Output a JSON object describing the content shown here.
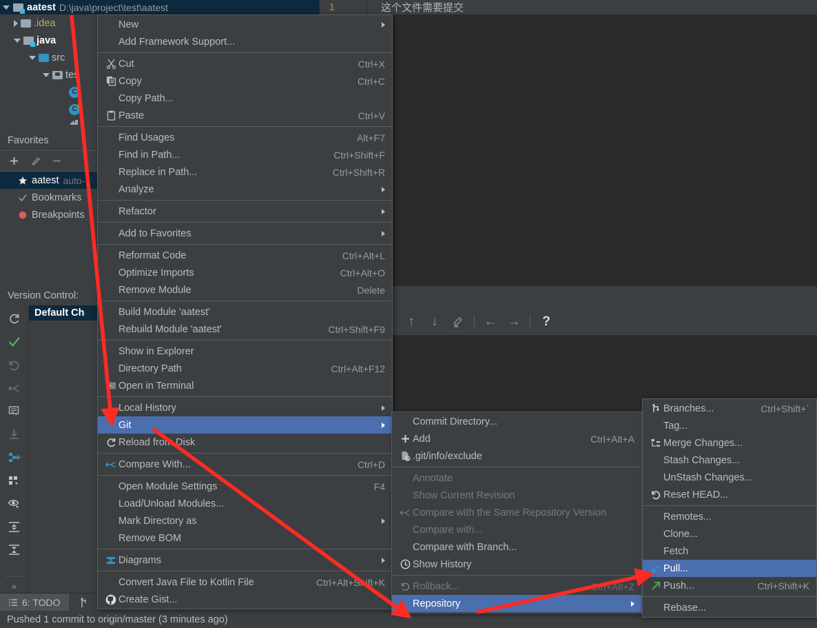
{
  "project_header": {
    "name": "aatest",
    "path": "D:\\java\\project\\test\\aatest",
    "expand_icon": "triangle-down-icon",
    "folder_icon": "module-folder-icon"
  },
  "editor_top": {
    "line_number": "1",
    "note": "这个文件需要提交"
  },
  "project_tree": {
    "items": [
      {
        "label": ".idea",
        "icon": "folder-icon",
        "arrow": "triangle-right-icon",
        "indent": 20,
        "style": "idea"
      },
      {
        "label": "java",
        "icon": "module-folder-icon",
        "arrow": "triangle-down-icon",
        "indent": 20,
        "style": "java"
      },
      {
        "label": "src",
        "icon": "source-folder-icon",
        "arrow": "triangle-down-icon",
        "indent": 42,
        "style": ""
      },
      {
        "label": "tes",
        "icon": "test-folder-icon",
        "arrow": "triangle-down-icon",
        "indent": 62,
        "style": ""
      },
      {
        "label": "",
        "icon": "class-icon",
        "arrow": "",
        "indent": 98,
        "style": ""
      },
      {
        "label": "",
        "icon": "runnable-class-icon",
        "arrow": "",
        "indent": 98,
        "style": ""
      },
      {
        "label": "",
        "icon": "resource-icon",
        "arrow": "",
        "indent": 98,
        "style": ""
      }
    ]
  },
  "favorites": {
    "title": "Favorites",
    "toolbar": [
      {
        "name": "add-favorite-button",
        "glyph": "+"
      },
      {
        "name": "edit-favorite-button",
        "glyph": "pencil-icon"
      },
      {
        "name": "remove-favorite-button",
        "glyph": "−"
      }
    ],
    "items": [
      {
        "label": "aatest",
        "sub": "auto-",
        "icon": "star-icon",
        "selected": true
      },
      {
        "label": "Bookmarks",
        "sub": "",
        "icon": "check-icon",
        "selected": false
      },
      {
        "label": "Breakpoints",
        "sub": "",
        "icon": "breakpoint-icon",
        "selected": false
      }
    ]
  },
  "version_control": {
    "title": "Version Control:",
    "changelist": "Default Ch",
    "toolbar_icons": [
      "refresh-icon",
      "commit-check-icon",
      "rollback-icon",
      "shelve-icon",
      "comment-icon",
      "update-icon",
      "merge-icon",
      "group-by-icon",
      "preview-icon",
      "expand-all-icon",
      "collapse-all-icon",
      "more-icon"
    ]
  },
  "diff_toolbar": {
    "buttons": [
      {
        "name": "previous-difference-button",
        "glyph": "↑"
      },
      {
        "name": "next-difference-button",
        "glyph": "↓"
      },
      {
        "name": "edit-source-button",
        "glyph": "pencil-icon"
      },
      {
        "name": "accept-left-button",
        "glyph": "←"
      },
      {
        "name": "accept-right-button",
        "glyph": "→"
      },
      {
        "name": "help-button",
        "glyph": "?"
      }
    ]
  },
  "context_menu": {
    "items": [
      {
        "label": "New",
        "key": "",
        "icon": "",
        "submenu": true,
        "sel": false,
        "dis": false,
        "sep_after": false,
        "ul": 0
      },
      {
        "label": "Add Framework Support...",
        "key": "",
        "icon": "",
        "submenu": false,
        "sel": false,
        "dis": false,
        "sep_after": true,
        "ul": 0
      },
      {
        "label": "Cut",
        "key": "Ctrl+X",
        "icon": "cut-icon",
        "submenu": false,
        "sel": false,
        "dis": false,
        "sep_after": false,
        "ul": 2
      },
      {
        "label": "Copy",
        "key": "Ctrl+C",
        "icon": "copy-icon",
        "submenu": false,
        "sel": false,
        "dis": false,
        "sep_after": false,
        "ul": 0
      },
      {
        "label": "Copy Path...",
        "key": "",
        "icon": "",
        "submenu": false,
        "sel": false,
        "dis": false,
        "sep_after": false,
        "ul": -1
      },
      {
        "label": "Paste",
        "key": "Ctrl+V",
        "icon": "paste-icon",
        "submenu": false,
        "sel": false,
        "dis": false,
        "sep_after": true,
        "ul": 0
      },
      {
        "label": "Find Usages",
        "key": "Alt+F7",
        "icon": "",
        "submenu": false,
        "sel": false,
        "dis": false,
        "sep_after": false,
        "ul": 5
      },
      {
        "label": "Find in Path...",
        "key": "Ctrl+Shift+F",
        "icon": "",
        "submenu": false,
        "sel": false,
        "dis": false,
        "sep_after": false,
        "ul": 8
      },
      {
        "label": "Replace in Path...",
        "key": "Ctrl+Shift+R",
        "icon": "",
        "submenu": false,
        "sel": false,
        "dis": false,
        "sep_after": false,
        "ul": 4
      },
      {
        "label": "Analyze",
        "key": "",
        "icon": "",
        "submenu": true,
        "sel": false,
        "dis": false,
        "sep_after": true,
        "ul": 5
      },
      {
        "label": "Refactor",
        "key": "",
        "icon": "",
        "submenu": true,
        "sel": false,
        "dis": false,
        "sep_after": true,
        "ul": 0
      },
      {
        "label": "Add to Favorites",
        "key": "",
        "icon": "",
        "submenu": true,
        "sel": false,
        "dis": false,
        "sep_after": true,
        "ul": 7
      },
      {
        "label": "Reformat Code",
        "key": "Ctrl+Alt+L",
        "icon": "",
        "submenu": false,
        "sel": false,
        "dis": false,
        "sep_after": false,
        "ul": 0
      },
      {
        "label": "Optimize Imports",
        "key": "Ctrl+Alt+O",
        "icon": "",
        "submenu": false,
        "sel": false,
        "dis": false,
        "sep_after": false,
        "ul": 7
      },
      {
        "label": "Remove Module",
        "key": "Delete",
        "icon": "",
        "submenu": false,
        "sel": false,
        "dis": false,
        "sep_after": true,
        "ul": -1
      },
      {
        "label": "Build Module 'aatest'",
        "key": "",
        "icon": "",
        "submenu": false,
        "sel": false,
        "dis": false,
        "sep_after": false,
        "ul": 6
      },
      {
        "label": "Rebuild Module 'aatest'",
        "key": "Ctrl+Shift+F9",
        "icon": "",
        "submenu": false,
        "sel": false,
        "dis": false,
        "sep_after": true,
        "ul": 1
      },
      {
        "label": "Show in Explorer",
        "key": "",
        "icon": "",
        "submenu": false,
        "sel": false,
        "dis": false,
        "sep_after": false,
        "ul": -1
      },
      {
        "label": "Directory Path",
        "key": "Ctrl+Alt+F12",
        "icon": "",
        "submenu": false,
        "sel": false,
        "dis": false,
        "sep_after": false,
        "ul": 10
      },
      {
        "label": "Open in Terminal",
        "key": "",
        "icon": "terminal-icon",
        "submenu": false,
        "sel": false,
        "dis": false,
        "sep_after": true,
        "ul": -1
      },
      {
        "label": "Local History",
        "key": "",
        "icon": "",
        "submenu": true,
        "sel": false,
        "dis": false,
        "sep_after": false,
        "ul": 6
      },
      {
        "label": "Git",
        "key": "",
        "icon": "",
        "submenu": true,
        "sel": true,
        "dis": false,
        "sep_after": false,
        "ul": 0
      },
      {
        "label": "Reload from Disk",
        "key": "",
        "icon": "reload-icon",
        "submenu": false,
        "sel": false,
        "dis": false,
        "sep_after": true,
        "ul": -1
      },
      {
        "label": "Compare With...",
        "key": "Ctrl+D",
        "icon": "compare-icon",
        "submenu": false,
        "sel": false,
        "dis": false,
        "sep_after": true,
        "ul": -1
      },
      {
        "label": "Open Module Settings",
        "key": "F4",
        "icon": "",
        "submenu": false,
        "sel": false,
        "dis": false,
        "sep_after": false,
        "ul": -1
      },
      {
        "label": "Load/Unload Modules...",
        "key": "",
        "icon": "",
        "submenu": false,
        "sel": false,
        "dis": false,
        "sep_after": false,
        "ul": -1
      },
      {
        "label": "Mark Directory as",
        "key": "",
        "icon": "",
        "submenu": true,
        "sel": false,
        "dis": false,
        "sep_after": false,
        "ul": -1
      },
      {
        "label": "Remove BOM",
        "key": "",
        "icon": "",
        "submenu": false,
        "sel": false,
        "dis": false,
        "sep_after": true,
        "ul": -1
      },
      {
        "label": "Diagrams",
        "key": "",
        "icon": "diagram-icon",
        "submenu": true,
        "sel": false,
        "dis": false,
        "sep_after": true,
        "ul": -1
      },
      {
        "label": "Convert Java File to Kotlin File",
        "key": "Ctrl+Alt+Shift+K",
        "icon": "",
        "submenu": false,
        "sel": false,
        "dis": false,
        "sep_after": false,
        "ul": -1
      },
      {
        "label": "Create Gist...",
        "key": "",
        "icon": "github-icon",
        "submenu": false,
        "sel": false,
        "dis": false,
        "sep_after": false,
        "ul": -1
      }
    ]
  },
  "git_menu": {
    "items": [
      {
        "label": "Commit Directory...",
        "key": "",
        "icon": "",
        "submenu": false,
        "sel": false,
        "dis": false,
        "sep_after": false,
        "ul": 5
      },
      {
        "label": "Add",
        "key": "Ctrl+Alt+A",
        "icon": "plus-icon",
        "submenu": false,
        "sel": false,
        "dis": false,
        "sep_after": false,
        "ul": -1
      },
      {
        "label": ".git/info/exclude",
        "key": "",
        "icon": "ignore-file-icon",
        "submenu": false,
        "sel": false,
        "dis": false,
        "sep_after": true,
        "ul": -1
      },
      {
        "label": "Annotate",
        "key": "",
        "icon": "",
        "submenu": false,
        "sel": false,
        "dis": true,
        "sep_after": false,
        "ul": 1
      },
      {
        "label": "Show Current Revision",
        "key": "",
        "icon": "",
        "submenu": false,
        "sel": false,
        "dis": true,
        "sep_after": false,
        "ul": -1
      },
      {
        "label": "Compare with the Same Repository Version",
        "key": "",
        "icon": "compare-icon",
        "submenu": false,
        "sel": false,
        "dis": true,
        "sep_after": false,
        "ul": 35
      },
      {
        "label": "Compare with...",
        "key": "",
        "icon": "",
        "submenu": false,
        "sel": false,
        "dis": true,
        "sep_after": false,
        "ul": 0
      },
      {
        "label": "Compare with Branch...",
        "key": "",
        "icon": "",
        "submenu": false,
        "sel": false,
        "dis": false,
        "sep_after": false,
        "ul": -1
      },
      {
        "label": "Show History",
        "key": "",
        "icon": "history-icon",
        "submenu": false,
        "sel": false,
        "dis": false,
        "sep_after": true,
        "ul": 5
      },
      {
        "label": "Rollback...",
        "key": "Ctrl+Alt+Z",
        "icon": "rollback-icon",
        "submenu": false,
        "sel": false,
        "dis": true,
        "sep_after": false,
        "ul": 0
      },
      {
        "label": "Repository",
        "key": "",
        "icon": "",
        "submenu": true,
        "sel": true,
        "dis": false,
        "sep_after": false,
        "ul": 0
      }
    ]
  },
  "repository_menu": {
    "items": [
      {
        "label": "Branches...",
        "key": "Ctrl+Shift+`",
        "icon": "branch-icon",
        "submenu": false,
        "sel": false,
        "dis": false,
        "sep_after": false,
        "ul": 0
      },
      {
        "label": "Tag...",
        "key": "",
        "icon": "",
        "submenu": false,
        "sel": false,
        "dis": false,
        "sep_after": false,
        "ul": -1
      },
      {
        "label": "Merge Changes...",
        "key": "",
        "icon": "merge-icon",
        "submenu": false,
        "sel": false,
        "dis": false,
        "sep_after": false,
        "ul": -1
      },
      {
        "label": "Stash Changes...",
        "key": "",
        "icon": "",
        "submenu": false,
        "sel": false,
        "dis": false,
        "sep_after": false,
        "ul": -1
      },
      {
        "label": "UnStash Changes...",
        "key": "",
        "icon": "",
        "submenu": false,
        "sel": false,
        "dis": false,
        "sep_after": false,
        "ul": -1
      },
      {
        "label": "Reset HEAD...",
        "key": "",
        "icon": "reset-icon",
        "submenu": false,
        "sel": false,
        "dis": false,
        "sep_after": true,
        "ul": -1
      },
      {
        "label": "Remotes...",
        "key": "",
        "icon": "",
        "submenu": false,
        "sel": false,
        "dis": false,
        "sep_after": false,
        "ul": -1
      },
      {
        "label": "Clone...",
        "key": "",
        "icon": "",
        "submenu": false,
        "sel": false,
        "dis": false,
        "sep_after": false,
        "ul": -1
      },
      {
        "label": "Fetch",
        "key": "",
        "icon": "",
        "submenu": false,
        "sel": false,
        "dis": false,
        "sep_after": false,
        "ul": -1
      },
      {
        "label": "Pull...",
        "key": "",
        "icon": "pull-icon",
        "submenu": false,
        "sel": true,
        "dis": false,
        "sep_after": false,
        "ul": -1
      },
      {
        "label": "Push...",
        "key": "Ctrl+Shift+K",
        "icon": "push-icon",
        "submenu": false,
        "sel": false,
        "dis": false,
        "sep_after": true,
        "ul": -1
      },
      {
        "label": "Rebase...",
        "key": "",
        "icon": "",
        "submenu": false,
        "sel": false,
        "dis": false,
        "sep_after": false,
        "ul": -1
      }
    ]
  },
  "bottom_tabs": [
    {
      "label": "6: TODO",
      "icon": "todo-icon",
      "active": true
    },
    {
      "label": "",
      "icon": "version-control-icon",
      "active": false
    }
  ],
  "status_bar": {
    "message": "Pushed 1 commit to origin/master (3 minutes ago)"
  },
  "colors": {
    "selection_blue": "#4b6eaf",
    "header_blue": "#0d293e",
    "panel_bg": "#3c3f41",
    "editor_bg": "#2b2b2b",
    "annotation_red": "#fc2b24",
    "text": "#bbbbbb",
    "disabled_text": "#787878",
    "folder_yellow": "#b3ae60"
  }
}
